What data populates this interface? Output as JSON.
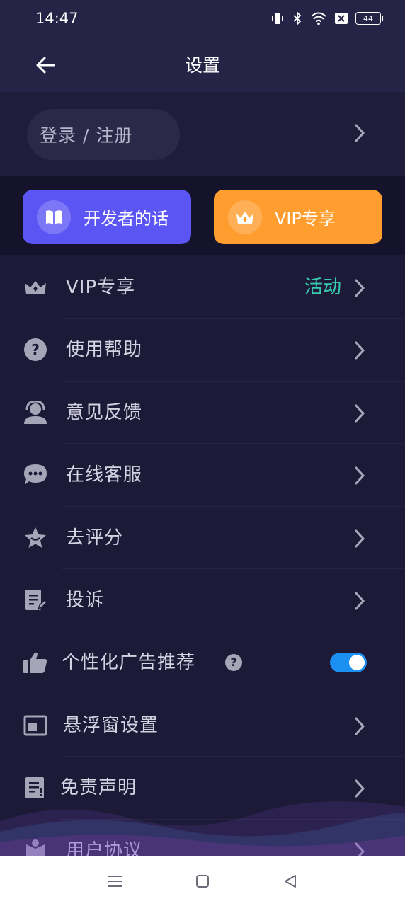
{
  "status_bar": {
    "time": "14:47",
    "battery": "44",
    "icons": [
      "vibrate-icon",
      "bluetooth-icon",
      "wifi-icon",
      "sim-off-icon",
      "battery-icon"
    ]
  },
  "header": {
    "title": "设置",
    "back_icon": "arrow-left-icon"
  },
  "login": {
    "label": "登录 / 注册"
  },
  "promo": {
    "developer_label": "开发者的话",
    "vip_label": "VIP专享",
    "developer_color": "#5b55f4",
    "vip_color": "#ff9d2e"
  },
  "menu": {
    "items": [
      {
        "label": "VIP专享",
        "icon": "crown-icon",
        "badge": "活动"
      },
      {
        "label": "使用帮助",
        "icon": "question-circle-icon"
      },
      {
        "label": "意见反馈",
        "icon": "headset-icon"
      },
      {
        "label": "在线客服",
        "icon": "chat-bubble-icon"
      },
      {
        "label": "去评分",
        "icon": "star-icon"
      },
      {
        "label": "投诉",
        "icon": "document-edit-icon"
      },
      {
        "label": "个性化广告推荐",
        "icon": "thumbs-up-icon",
        "toggle": true
      },
      {
        "label": "悬浮窗设置",
        "icon": "floating-window-icon"
      },
      {
        "label": "免责声明",
        "icon": "notice-icon"
      },
      {
        "label": "用户协议",
        "icon": "user-agreement-icon"
      }
    ],
    "badge_color": "#38c9b2",
    "toggle_color": "#1c8ff2"
  },
  "nav_bar": {
    "icons": [
      "menu-icon",
      "home-square-icon",
      "back-triangle-icon"
    ]
  }
}
